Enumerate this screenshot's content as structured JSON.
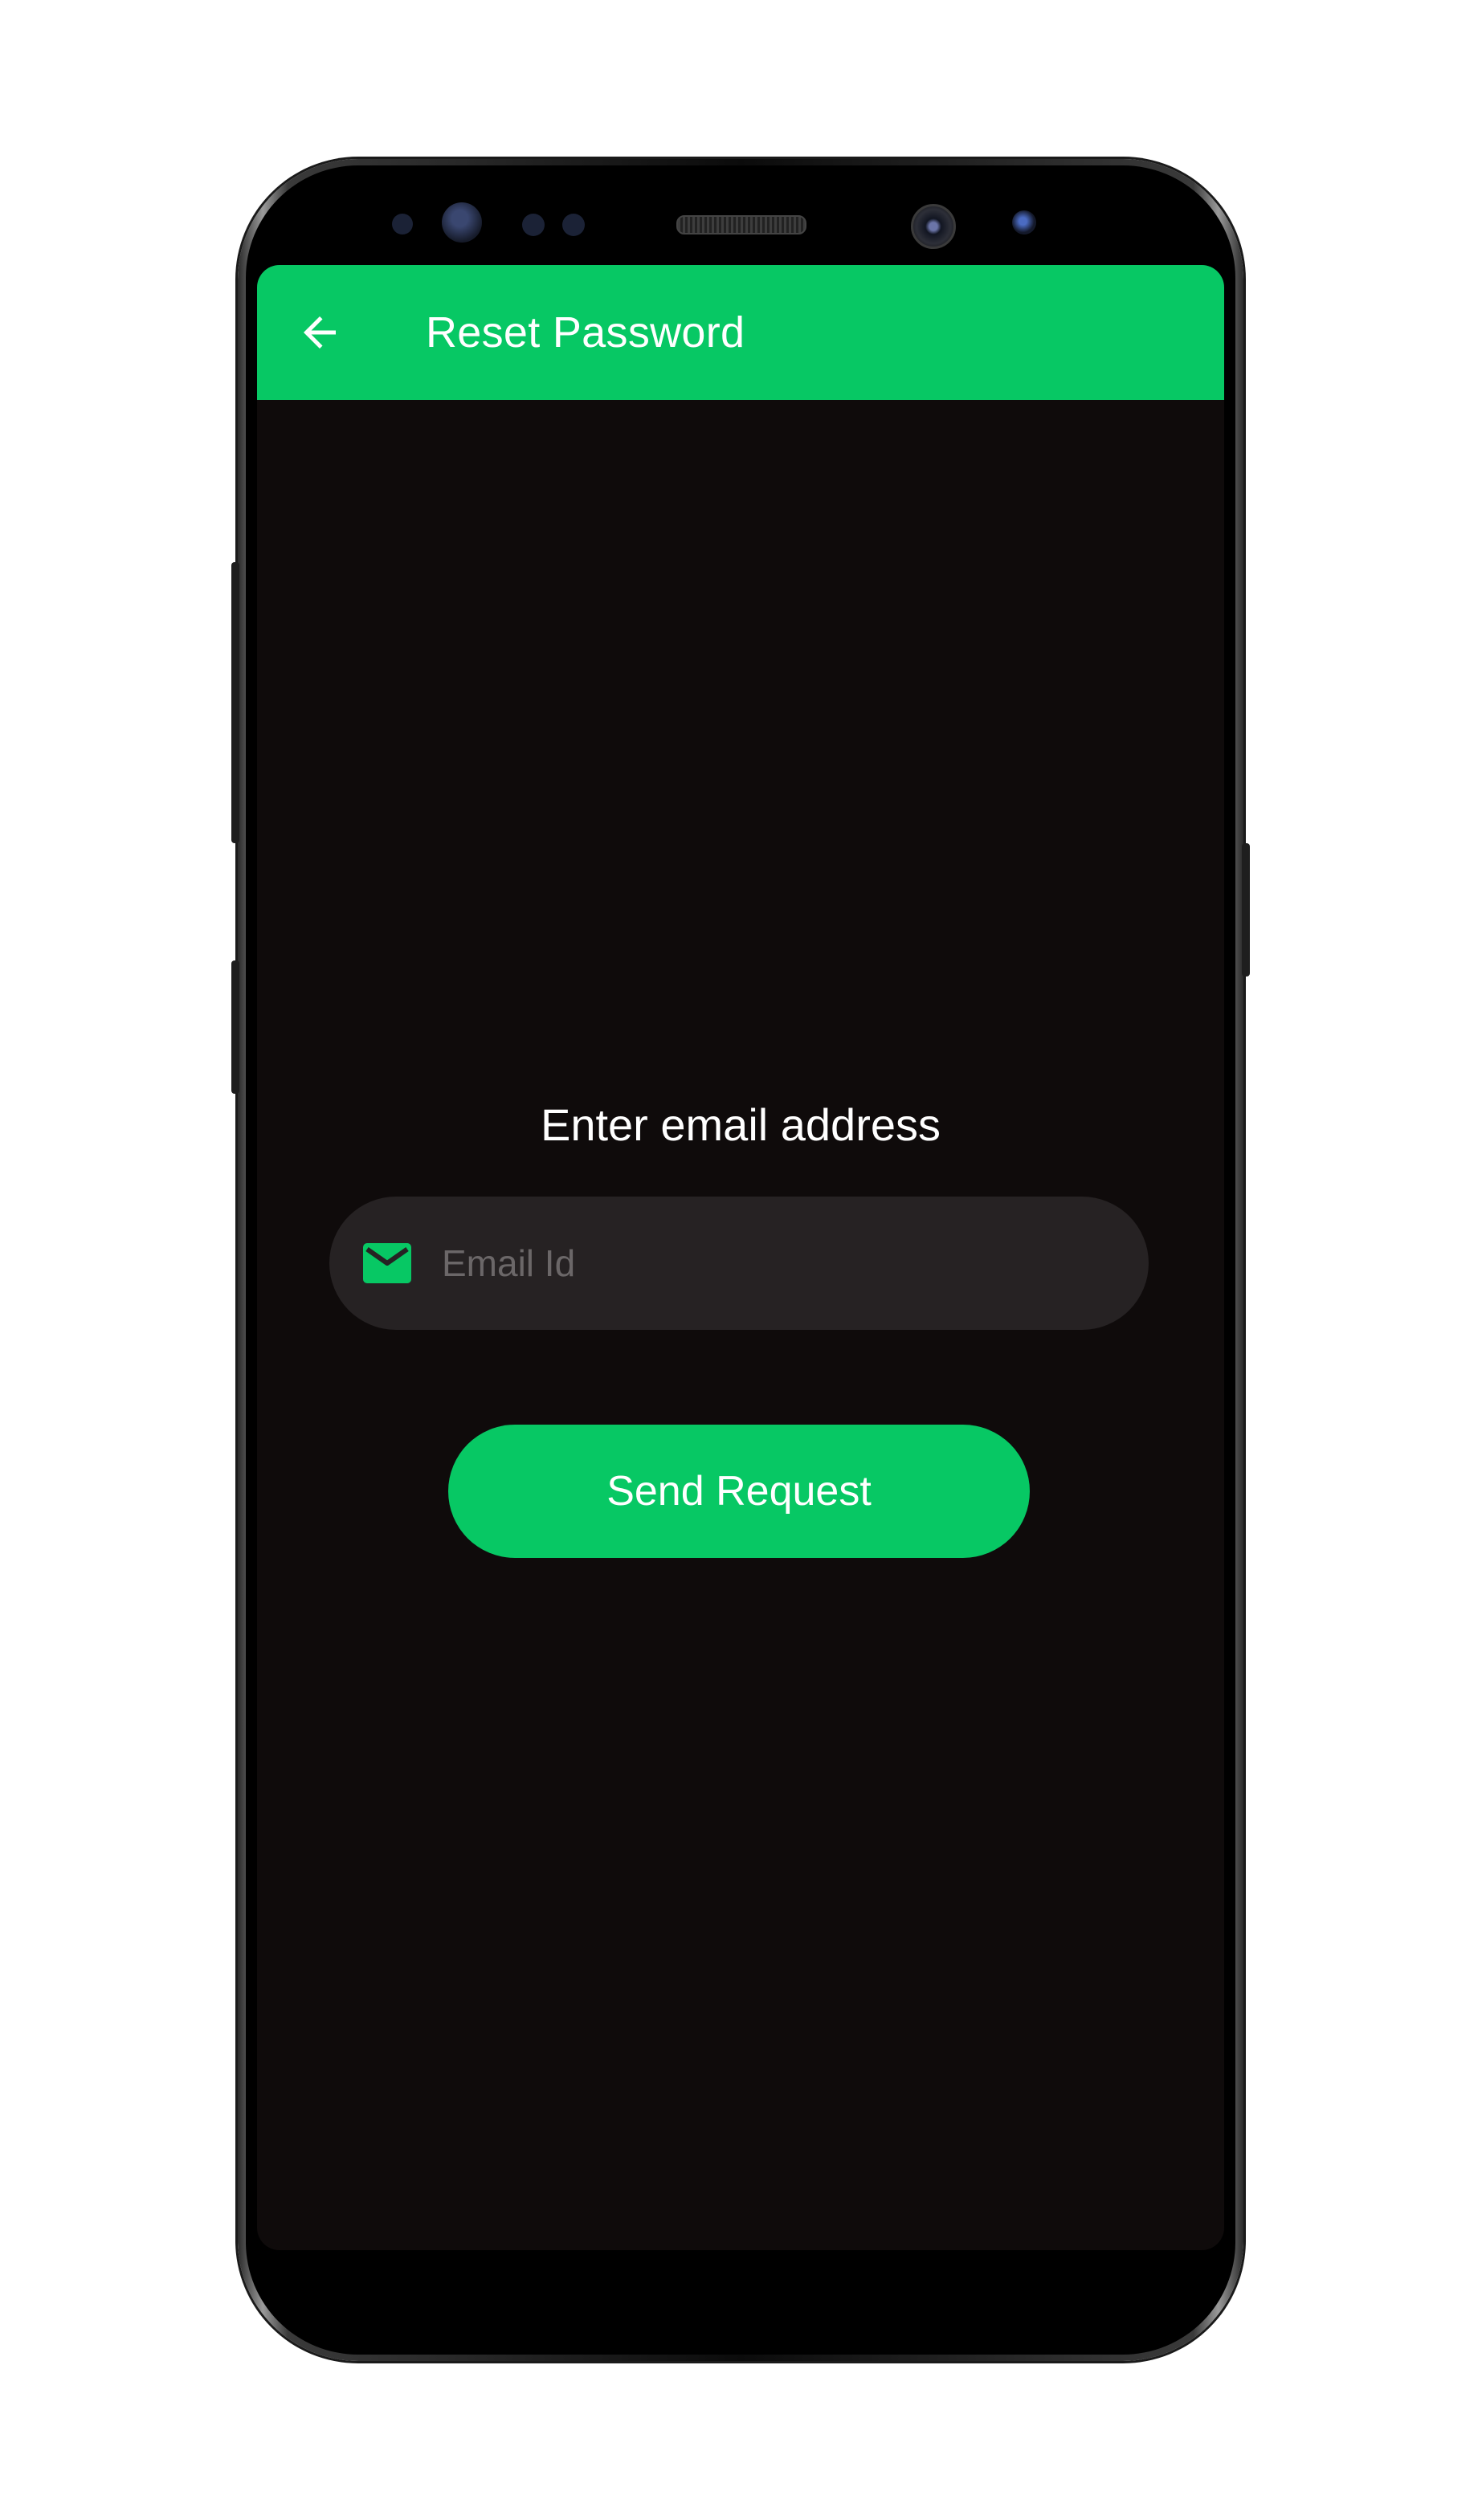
{
  "appbar": {
    "title": "Reset Password",
    "back_icon": "arrow-left-icon"
  },
  "content": {
    "heading": "Enter email address",
    "email_field": {
      "placeholder": "Email Id",
      "value": "",
      "icon": "mail-icon"
    },
    "send_button_label": "Send Request"
  },
  "colors": {
    "accent": "#07c864",
    "screen_background": "#0f0b0b",
    "field_background": "#262223",
    "placeholder": "#6b6768"
  }
}
